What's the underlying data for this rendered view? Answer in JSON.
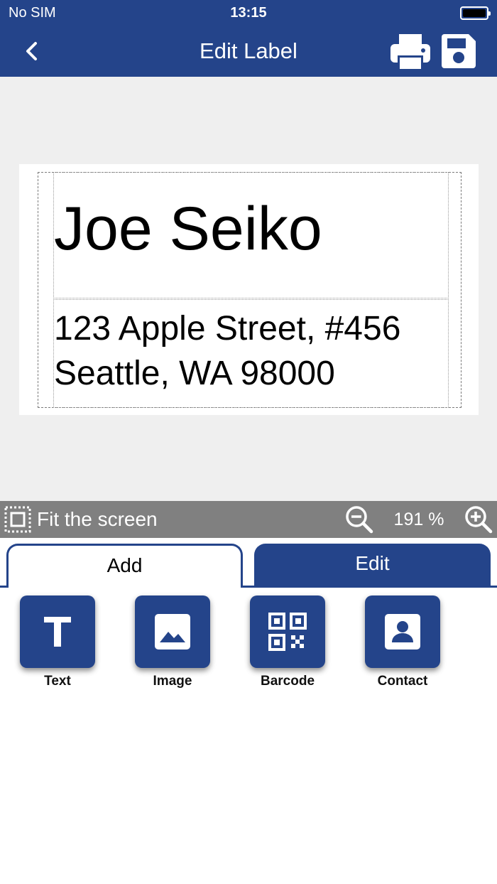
{
  "status": {
    "carrier": "No SIM",
    "time": "13:15"
  },
  "nav": {
    "title": "Edit Label",
    "back_icon": "chevron-left-icon",
    "print_icon": "printer-icon",
    "save_icon": "floppy-disk-icon"
  },
  "label": {
    "name": "Joe Seiko",
    "address_line1": "123 Apple Street, #456",
    "address_line2": "Seattle, WA 98000"
  },
  "zoom": {
    "fit_label": "Fit the screen",
    "value": "191 %"
  },
  "tabs": [
    {
      "label": "Add",
      "selected": true
    },
    {
      "label": "Edit",
      "selected": false
    }
  ],
  "tools": [
    {
      "label": "Text",
      "icon": "text-icon"
    },
    {
      "label": "Image",
      "icon": "image-icon"
    },
    {
      "label": "Barcode",
      "icon": "qr-code-icon"
    },
    {
      "label": "Contact",
      "icon": "contact-icon"
    }
  ],
  "colors": {
    "primary": "#24448a",
    "toolbar_gray": "#808080",
    "canvas_bg": "#efefef"
  }
}
